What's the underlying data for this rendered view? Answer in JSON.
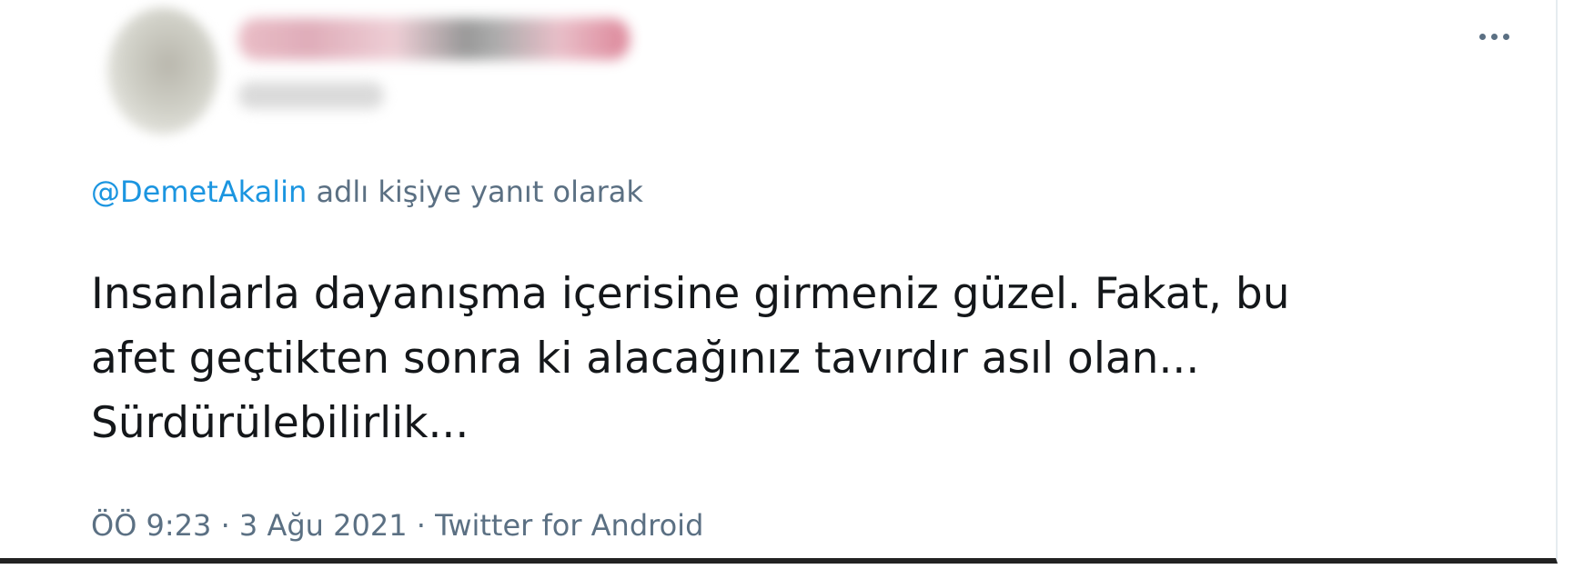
{
  "tweet": {
    "reply_to": {
      "mention": "@DemetAkalin",
      "suffix": "adlı kişiye yanıt olarak"
    },
    "text": "Insanlarla dayanışma içerisine girmeniz güzel. Fakat, bu\nafet geçtikten sonra ki alacağınız tavırdır asıl olan...\nSürdürülebilirlik...",
    "time": "ÖÖ 9:23",
    "separator": " · ",
    "date": "3 Ağu 2021",
    "source": "Twitter for Android"
  },
  "icons": {
    "more": "more-horizontal-icon"
  },
  "colors": {
    "mention": "#1b95e0",
    "secondary_text": "#5b7083",
    "primary_text": "#14171a",
    "background": "#ffffff"
  }
}
